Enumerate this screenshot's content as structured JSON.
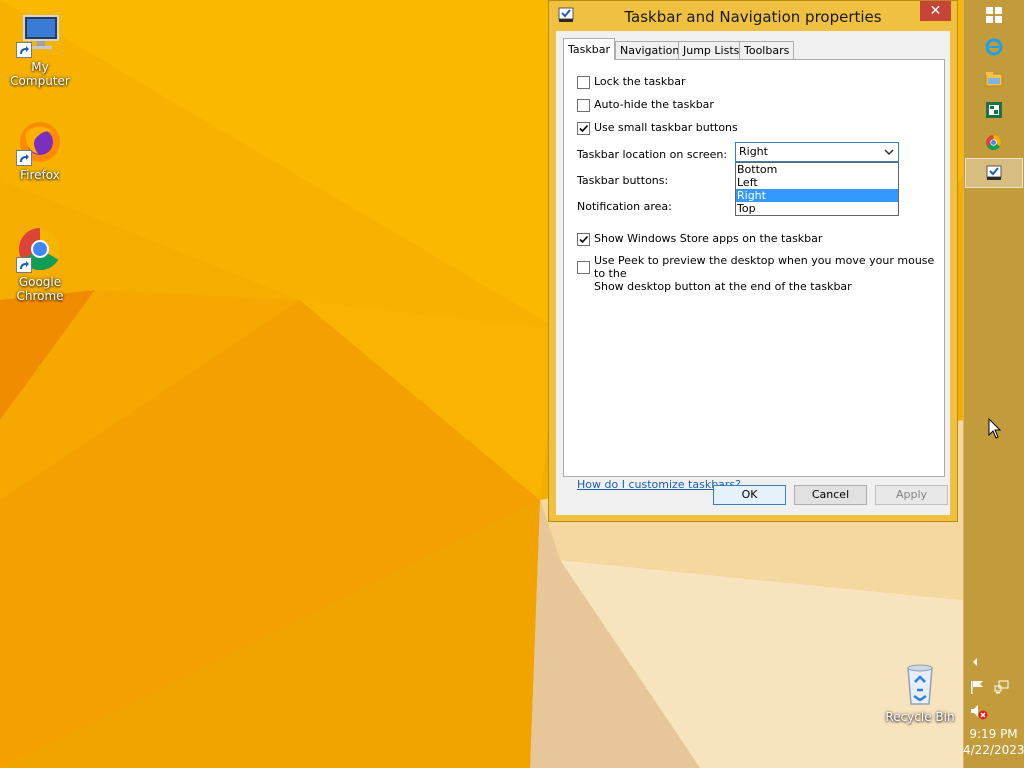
{
  "desktop": {
    "icons": [
      {
        "label": "My Computer"
      },
      {
        "label": "Firefox"
      },
      {
        "label": "Google Chrome"
      },
      {
        "label": "Recycle Bin"
      }
    ]
  },
  "dialog": {
    "title": "Taskbar and Navigation properties",
    "close_glyph": "✕",
    "tabs": [
      {
        "label": "Taskbar",
        "selected": true
      },
      {
        "label": "Navigation",
        "selected": false
      },
      {
        "label": "Jump Lists",
        "selected": false
      },
      {
        "label": "Toolbars",
        "selected": false
      }
    ],
    "options": {
      "lock_taskbar": {
        "label": "Lock the taskbar",
        "checked": false
      },
      "auto_hide": {
        "label": "Auto-hide the taskbar",
        "checked": false
      },
      "small_buttons": {
        "label": "Use small taskbar buttons",
        "checked": true
      },
      "store_apps": {
        "label": "Show Windows Store apps on the taskbar",
        "checked": true
      },
      "peek_line1": {
        "label": "Use Peek to preview the desktop when you move your mouse to the",
        "checked": false
      },
      "peek_line2": {
        "label": "Show desktop button at the end of the taskbar"
      }
    },
    "location_label": "Taskbar location on screen:",
    "location_value": "Right",
    "location_options": [
      "Bottom",
      "Left",
      "Right",
      "Top"
    ],
    "buttons_label": "Taskbar buttons:",
    "notification_label": "Notification area:",
    "help_link": "How do I customize taskbars?",
    "ok": "OK",
    "cancel": "Cancel",
    "apply": "Apply"
  },
  "taskbar": {
    "time": "9:19 PM",
    "date": "4/22/2023",
    "pinned": [
      "start-icon",
      "internet-explorer-icon",
      "file-explorer-icon",
      "excel-icon",
      "chrome-icon",
      "taskbar-properties-icon"
    ]
  },
  "colors": {
    "wallpaper_base": "#f2a900",
    "taskbar": "#c29b3c",
    "dialog_frame": "#f0c040",
    "selection": "#3399ff",
    "link": "#1a5fb4"
  }
}
